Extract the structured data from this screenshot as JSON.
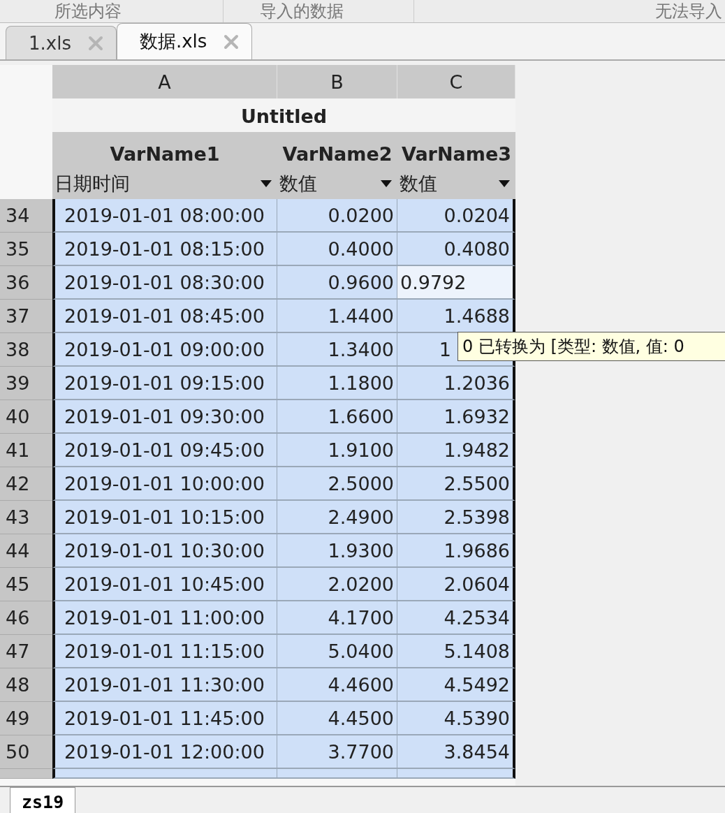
{
  "header_bar": {
    "labels": [
      "所选内容",
      "导入的数据",
      "无法导入"
    ]
  },
  "file_tabs": [
    {
      "label": "1.xls",
      "selected": false
    },
    {
      "label": "数据.xls",
      "selected": true
    }
  ],
  "sheet": {
    "title": "Untitled",
    "columns": [
      {
        "letter": "A",
        "name": "VarName1",
        "type": "日期时间"
      },
      {
        "letter": "B",
        "name": "VarName2",
        "type": "数值"
      },
      {
        "letter": "C",
        "name": "VarName3",
        "type": "数值"
      }
    ],
    "rows": [
      {
        "number": "34",
        "selected": true,
        "cells": [
          {
            "text": "2019-01-01 08:00:00",
            "editing": false
          },
          {
            "text": "0.0200",
            "editing": false
          },
          {
            "text": "0.0204",
            "editing": false
          }
        ]
      },
      {
        "number": "35",
        "selected": true,
        "cells": [
          {
            "text": "2019-01-01 08:15:00",
            "editing": false
          },
          {
            "text": "0.4000",
            "editing": false
          },
          {
            "text": "0.4080",
            "editing": false
          }
        ]
      },
      {
        "number": "36",
        "selected": true,
        "cells": [
          {
            "text": "2019-01-01 08:30:00",
            "editing": false
          },
          {
            "text": "0.9600",
            "editing": false
          },
          {
            "text": "0.9792",
            "editing": true
          }
        ]
      },
      {
        "number": "37",
        "selected": true,
        "cells": [
          {
            "text": "2019-01-01 08:45:00",
            "editing": false
          },
          {
            "text": "1.4400",
            "editing": false
          },
          {
            "text": "1.4688",
            "editing": false
          }
        ]
      },
      {
        "number": "38",
        "selected": true,
        "cells": [
          {
            "text": "2019-01-01 09:00:00",
            "editing": false
          },
          {
            "text": "1.3400",
            "editing": false
          },
          {
            "text": "1",
            "editing": false,
            "tooltip": "0 已转换为 [类型: 数值, 值: 0"
          }
        ]
      },
      {
        "number": "39",
        "selected": true,
        "cells": [
          {
            "text": "2019-01-01 09:15:00",
            "editing": false
          },
          {
            "text": "1.1800",
            "editing": false
          },
          {
            "text": "1.2036",
            "editing": false
          }
        ]
      },
      {
        "number": "40",
        "selected": true,
        "cells": [
          {
            "text": "2019-01-01 09:30:00",
            "editing": false
          },
          {
            "text": "1.6600",
            "editing": false
          },
          {
            "text": "1.6932",
            "editing": false
          }
        ]
      },
      {
        "number": "41",
        "selected": true,
        "cells": [
          {
            "text": "2019-01-01 09:45:00",
            "editing": false
          },
          {
            "text": "1.9100",
            "editing": false
          },
          {
            "text": "1.9482",
            "editing": false
          }
        ]
      },
      {
        "number": "42",
        "selected": true,
        "cells": [
          {
            "text": "2019-01-01 10:00:00",
            "editing": false
          },
          {
            "text": "2.5000",
            "editing": false
          },
          {
            "text": "2.5500",
            "editing": false
          }
        ]
      },
      {
        "number": "43",
        "selected": true,
        "cells": [
          {
            "text": "2019-01-01 10:15:00",
            "editing": false
          },
          {
            "text": "2.4900",
            "editing": false
          },
          {
            "text": "2.5398",
            "editing": false
          }
        ]
      },
      {
        "number": "44",
        "selected": true,
        "cells": [
          {
            "text": "2019-01-01 10:30:00",
            "editing": false
          },
          {
            "text": "1.9300",
            "editing": false
          },
          {
            "text": "1.9686",
            "editing": false
          }
        ]
      },
      {
        "number": "45",
        "selected": true,
        "cells": [
          {
            "text": "2019-01-01 10:45:00",
            "editing": false
          },
          {
            "text": "2.0200",
            "editing": false
          },
          {
            "text": "2.0604",
            "editing": false
          }
        ]
      },
      {
        "number": "46",
        "selected": true,
        "cells": [
          {
            "text": "2019-01-01 11:00:00",
            "editing": false
          },
          {
            "text": "4.1700",
            "editing": false
          },
          {
            "text": "4.2534",
            "editing": false
          }
        ]
      },
      {
        "number": "47",
        "selected": true,
        "cells": [
          {
            "text": "2019-01-01 11:15:00",
            "editing": false
          },
          {
            "text": "5.0400",
            "editing": false
          },
          {
            "text": "5.1408",
            "editing": false
          }
        ]
      },
      {
        "number": "48",
        "selected": true,
        "cells": [
          {
            "text": "2019-01-01 11:30:00",
            "editing": false
          },
          {
            "text": "4.4600",
            "editing": false
          },
          {
            "text": "4.5492",
            "editing": false
          }
        ]
      },
      {
        "number": "49",
        "selected": true,
        "cells": [
          {
            "text": "2019-01-01 11:45:00",
            "editing": false
          },
          {
            "text": "4.4500",
            "editing": false
          },
          {
            "text": "4.5390",
            "editing": false
          }
        ]
      },
      {
        "number": "50",
        "selected": true,
        "cells": [
          {
            "text": "2019-01-01 12:00:00",
            "editing": false
          },
          {
            "text": "3.7700",
            "editing": false
          },
          {
            "text": "3.8454",
            "editing": false
          }
        ]
      }
    ]
  },
  "sheet_tabs": [
    {
      "label": "zs19",
      "selected": true
    }
  ]
}
